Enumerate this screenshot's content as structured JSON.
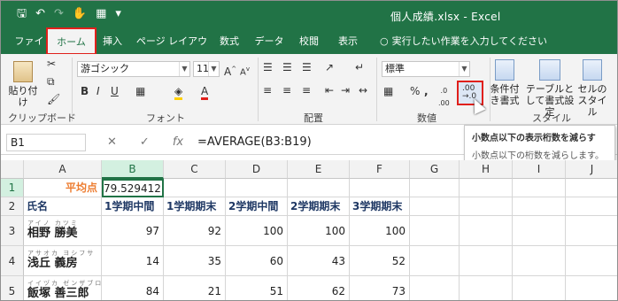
{
  "window": {
    "title": "個人成績.xlsx  -  Excel"
  },
  "tabs": [
    {
      "label": "ファイル"
    },
    {
      "label": "ホーム"
    },
    {
      "label": "挿入"
    },
    {
      "label": "ページ レイアウト"
    },
    {
      "label": "数式"
    },
    {
      "label": "データ"
    },
    {
      "label": "校閲"
    },
    {
      "label": "表示"
    }
  ],
  "tellme": {
    "placeholder": "実行したい作業を入力してください"
  },
  "ribbon": {
    "paste_label": "貼り付け",
    "font_name": "游ゴシック",
    "font_size": "11",
    "number_format": "標準",
    "cond_format_label": "条件付き書式",
    "table_format_label": "テーブルとして書式設定",
    "cell_style_label": "セルのスタイル",
    "groups": [
      "クリップボード",
      "フォント",
      "配置",
      "数値",
      "スタイル"
    ]
  },
  "tooltip": {
    "title": "小数点以下の表示桁数を減らす",
    "desc": "小数点以下の桁数を減らします。"
  },
  "formula_bar": {
    "name_box": "B1",
    "formula": "=AVERAGE(B3:B19)"
  },
  "sheet": {
    "columns": [
      "A",
      "B",
      "C",
      "D",
      "E",
      "F",
      "G",
      "H",
      "I",
      "J"
    ],
    "rows": [
      "1",
      "2",
      "3",
      "4",
      "5"
    ],
    "avg_label": "平均点",
    "avg_value": "79.529412",
    "headers": [
      "氏名",
      "1学期中間",
      "1学期期末",
      "2学期中間",
      "2学期期末",
      "3学期期末"
    ],
    "students": [
      {
        "ruby": "アイノ  カツミ",
        "name": "相野 勝美",
        "scores": [
          "97",
          "92",
          "100",
          "100",
          "100"
        ]
      },
      {
        "ruby": "アサオカ  ヨシフサ",
        "name": "浅丘 義房",
        "scores": [
          "14",
          "35",
          "60",
          "43",
          "52"
        ]
      },
      {
        "ruby": "イイヅカ  ゼンザブロウ",
        "name": "飯塚 善三郎",
        "scores": [
          "84",
          "21",
          "51",
          "62",
          "73"
        ]
      }
    ]
  },
  "colors": {
    "excel_green": "#217346",
    "highlight_red": "#e0201b",
    "avg_label_color": "#ed7d31"
  }
}
